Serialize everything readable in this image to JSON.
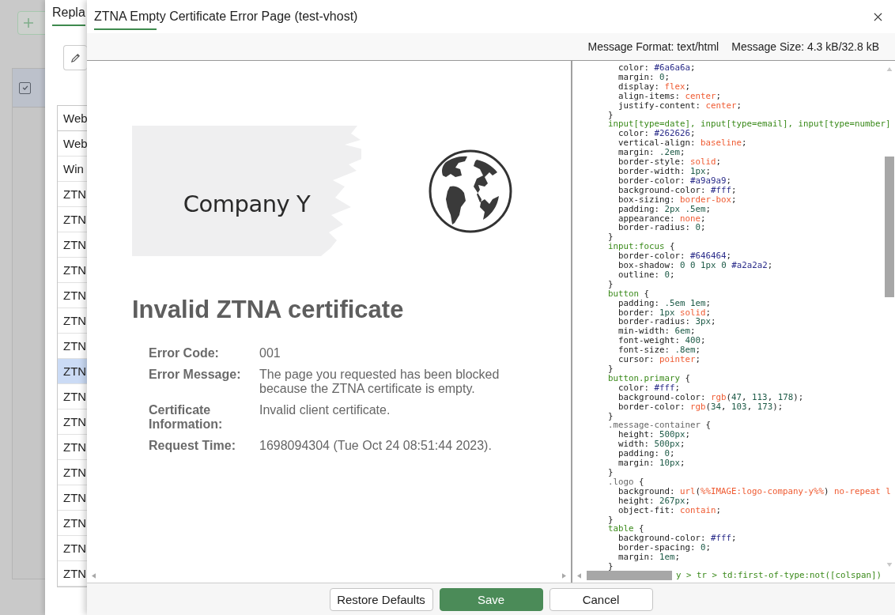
{
  "background_page": {
    "header_checkbox": {
      "checked": true
    }
  },
  "back_dialog": {
    "title": "Repla",
    "list": {
      "header": "Web",
      "rows": [
        {
          "label": "Web",
          "selected": false
        },
        {
          "label": "Win",
          "selected": false
        },
        {
          "label": "ZTN",
          "selected": false
        },
        {
          "label": "ZTN",
          "selected": false
        },
        {
          "label": "ZTN",
          "selected": false
        },
        {
          "label": "ZTN",
          "selected": false
        },
        {
          "label": "ZTN",
          "selected": false
        },
        {
          "label": "ZTN",
          "selected": false
        },
        {
          "label": "ZTN",
          "selected": false
        },
        {
          "label": "ZTN",
          "selected": true
        },
        {
          "label": "ZTN",
          "selected": false
        },
        {
          "label": "ZTN",
          "selected": false
        },
        {
          "label": "ZTN",
          "selected": false
        },
        {
          "label": "ZTN",
          "selected": false
        },
        {
          "label": "ZTN",
          "selected": false
        },
        {
          "label": "ZTN",
          "selected": false
        },
        {
          "label": "ZTN",
          "selected": false
        },
        {
          "label": "ZTN",
          "selected": false
        }
      ]
    }
  },
  "dialog": {
    "title": "ZTNA Empty Certificate Error Page (test-vhost)",
    "message_format": "Message Format: text/html",
    "message_size": "Message Size: 4.3 kB/32.8 kB",
    "preview": {
      "logo_text": "Company Y",
      "heading": "Invalid ZTNA certificate",
      "fields": [
        {
          "label": "Error Code:",
          "value": "001"
        },
        {
          "label": "Error Message:",
          "value": "The page you requested has been blocked because the ZTNA certificate is empty."
        },
        {
          "label": "Certificate Information:",
          "value": "Invalid client certificate."
        },
        {
          "label": "Request Time:",
          "value": "1698094304 (Tue Oct 24 08:51:44 2023)."
        }
      ]
    },
    "code": {
      "lines": [
        "    color: #6a6a6a;",
        "    margin: 0;",
        "    display: flex;",
        "    align-items: center;",
        "    justify-content: center;",
        "  }",
        "  input[type=date], input[type=email], input[type=number]",
        "    color: #262626;",
        "    vertical-align: baseline;",
        "    margin: .2em;",
        "    border-style: solid;",
        "    border-width: 1px;",
        "    border-color: #a9a9a9;",
        "    background-color: #fff;",
        "    box-sizing: border-box;",
        "    padding: 2px .5em;",
        "    appearance: none;",
        "    border-radius: 0;",
        "  }",
        "  input:focus {",
        "    border-color: #646464;",
        "    box-shadow: 0 0 1px 0 #a2a2a2;",
        "    outline: 0;",
        "  }",
        "  button {",
        "    padding: .5em 1em;",
        "    border: 1px solid;",
        "    border-radius: 3px;",
        "    min-width: 6em;",
        "    font-weight: 400;",
        "    font-size: .8em;",
        "    cursor: pointer;",
        "  }",
        "  button.primary {",
        "    color: #fff;",
        "    background-color: rgb(47, 113, 178);",
        "    border-color: rgb(34, 103, 173);",
        "  }",
        "  .message-container {",
        "    height: 500px;",
        "    width: 500px;",
        "    padding: 0;",
        "    margin: 10px;",
        "  }",
        "  .logo {",
        "    background: url(%%IMAGE:logo-company-y%%) no-repeat l",
        "    height: 267px;",
        "    object-fit: contain;",
        "  }",
        "  table {",
        "    background-color: #fff;",
        "    border-spacing: 0;",
        "    margin: 1em;",
        "  }"
      ],
      "last_line_fragment": "y > tr > td:first-of-type:not([colspan])"
    },
    "buttons": [
      {
        "label": "Restore Defaults",
        "kind": "default"
      },
      {
        "label": "Save",
        "kind": "primary"
      },
      {
        "label": "Cancel",
        "kind": "default"
      }
    ]
  }
}
